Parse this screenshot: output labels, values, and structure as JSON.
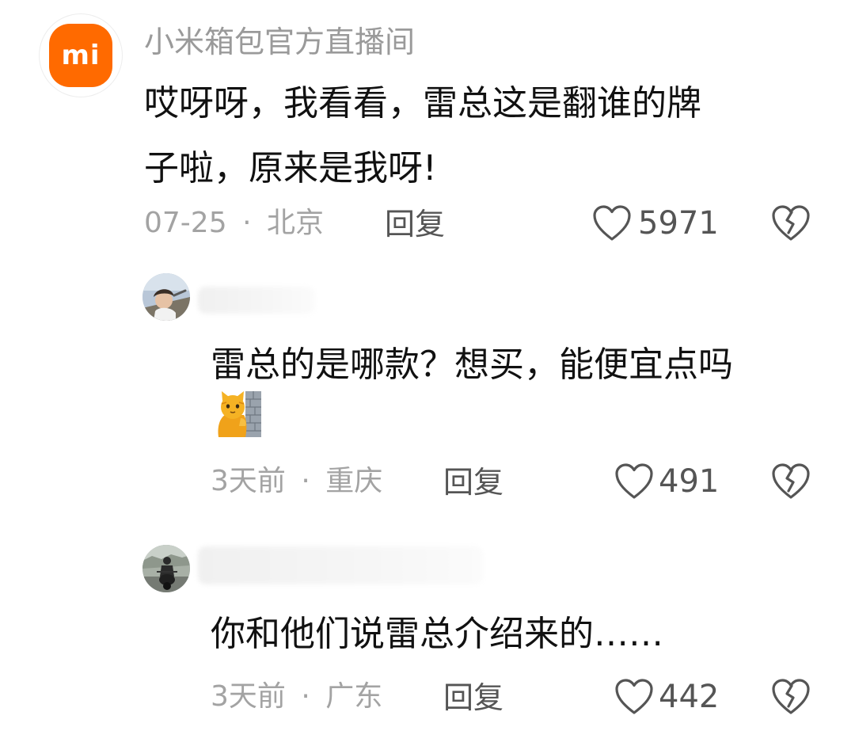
{
  "comments": [
    {
      "username": "小米箱包官方直播间",
      "text_line1": "哎呀呀，我看看，雷总这是翻谁的牌",
      "text_line2": "子啦，原来是我呀!",
      "date": "07-25",
      "location": "北京",
      "reply_label": "回复",
      "likes": "5971",
      "avatar_text": "mi"
    },
    {
      "text": "雷总的是哪款？想买，能便宜点吗",
      "emoji_icon": "cat-peeking-wall-icon",
      "date": "3天前",
      "location": "重庆",
      "reply_label": "回复",
      "likes": "491"
    },
    {
      "text": "你和他们说雷总介绍来的……",
      "date": "3天前",
      "location": "广东",
      "reply_label": "回复",
      "likes": "442"
    }
  ],
  "separator": "·",
  "colors": {
    "brand_orange": "#ff6a00",
    "meta_gray": "#a3a3a3",
    "icon_gray": "#555555"
  }
}
